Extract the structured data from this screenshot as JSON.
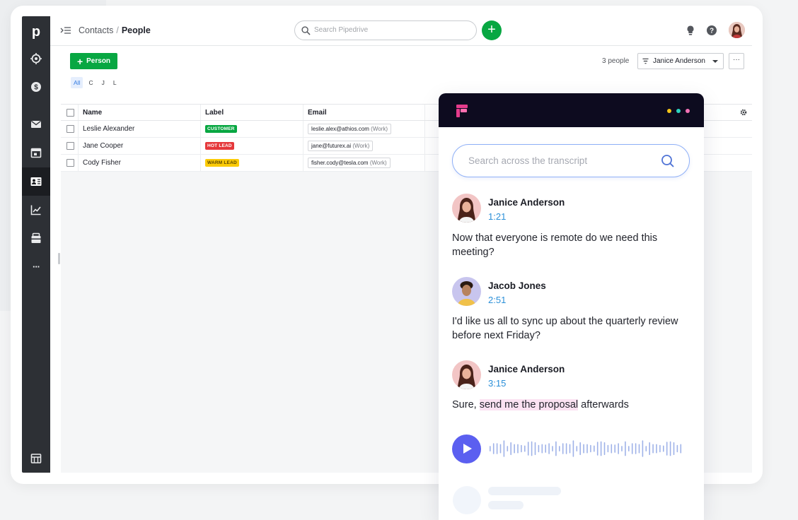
{
  "header": {
    "breadcrumb_root": "Contacts",
    "breadcrumb_sep": "/",
    "breadcrumb_current": "People",
    "search_placeholder": "Search Pipedrive",
    "add_icon": "plus-icon"
  },
  "sidebar": {
    "logo": "p",
    "items": [
      {
        "name": "target-icon"
      },
      {
        "name": "dollar-icon"
      },
      {
        "name": "mail-icon"
      },
      {
        "name": "calendar-icon"
      },
      {
        "name": "contacts-icon",
        "active": true
      },
      {
        "name": "chart-icon"
      },
      {
        "name": "box-icon"
      },
      {
        "name": "more-icon",
        "glyph": "···"
      },
      {
        "name": "marketplace-icon"
      }
    ]
  },
  "toolbar": {
    "add_person_label": "Person",
    "filters": [
      "All",
      "C",
      "J",
      "L"
    ],
    "count_text": "3 people",
    "owner_filter": "Janice Anderson",
    "more_label": "···"
  },
  "table": {
    "columns": [
      "Name",
      "Label",
      "Email"
    ],
    "rows": [
      {
        "name": "Leslie Alexander",
        "label": "CUSTOMER",
        "label_color": "#08a742",
        "label_text_color": "#ffffff",
        "email": "leslie.alex@athios.com",
        "email_type": "(Work)"
      },
      {
        "name": "Jane Cooper",
        "label": "HOT LEAD",
        "label_color": "#e5383b",
        "label_text_color": "#ffffff",
        "email": "jane@futurex.ai",
        "email_type": "(Work)"
      },
      {
        "name": "Cody Fisher",
        "label": "WARM LEAD",
        "label_color": "#fbcb07",
        "label_text_color": "#5a4600",
        "email": "fisher.cody@tesla.com",
        "email_type": "(Work)"
      }
    ]
  },
  "transcript": {
    "search_placeholder": "Search across the transcript",
    "dots": [
      "#f5c518",
      "#2dd4bf",
      "#f472b6"
    ],
    "messages": [
      {
        "speaker": "Janice Anderson",
        "time": "1:21",
        "text": "Now that everyone is remote do we need this meeting?"
      },
      {
        "speaker": "Jacob Jones",
        "time": "2:51",
        "text": "I'd like us all to sync up about the quarterly review before next Friday?"
      },
      {
        "speaker": "Janice Anderson",
        "time": "3:15",
        "text_before": "Sure, ",
        "text_highlight": "send me the proposal",
        "text_after": " afterwards"
      }
    ],
    "accent_color": "#5b5ff0"
  }
}
